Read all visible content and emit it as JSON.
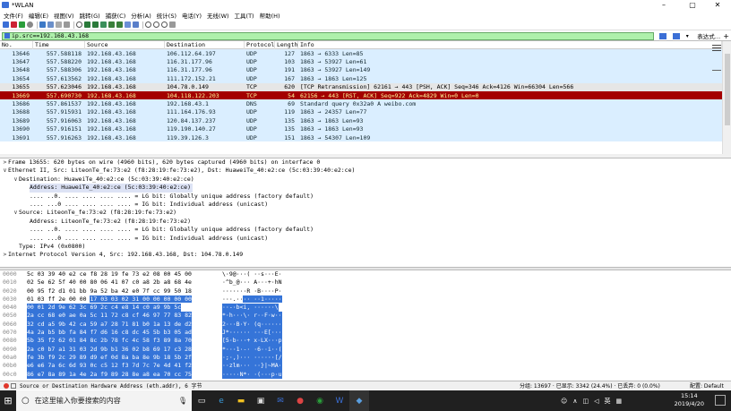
{
  "window": {
    "title": "*WLAN",
    "min": "–",
    "max": "▢",
    "close": "✕"
  },
  "menu": [
    "文件(F)",
    "编辑(E)",
    "视图(V)",
    "跳转(G)",
    "捕获(C)",
    "分析(A)",
    "统计(S)",
    "电话(Y)",
    "无线(W)",
    "工具(T)",
    "帮助(H)"
  ],
  "filter": {
    "value": "ip.src==192.168.43.168",
    "expression_label": "表达式…"
  },
  "columns": [
    "No.",
    "Time",
    "Source",
    "Destination",
    "Protocol",
    "Length",
    "Info"
  ],
  "packets": [
    {
      "no": "13646",
      "time": "557.588118",
      "src": "192.168.43.168",
      "dst": "106.112.64.197",
      "proto": "UDP",
      "len": "127",
      "info": "1863 → 6333 Len=85",
      "style": "udp"
    },
    {
      "no": "13647",
      "time": "557.588220",
      "src": "192.168.43.168",
      "dst": "116.31.177.96",
      "proto": "UDP",
      "len": "103",
      "info": "1863 → 53927 Len=61",
      "style": "udp"
    },
    {
      "no": "13648",
      "time": "557.588306",
      "src": "192.168.43.168",
      "dst": "116.31.177.96",
      "proto": "UDP",
      "len": "191",
      "info": "1863 → 53927 Len=149",
      "style": "udp"
    },
    {
      "no": "13654",
      "time": "557.613562",
      "src": "192.168.43.168",
      "dst": "111.172.152.21",
      "proto": "UDP",
      "len": "167",
      "info": "1863 → 1863 Len=125",
      "style": "udp"
    },
    {
      "no": "13655",
      "time": "557.623046",
      "src": "192.168.43.168",
      "dst": "104.78.0.149",
      "proto": "TCP",
      "len": "620",
      "info": "[TCP Retransmission] 62161 → 443 [PSH, ACK] Seq=346 Ack=4126 Win=66304 Len=566",
      "style": "retrans"
    },
    {
      "no": "13669",
      "time": "557.690730",
      "src": "192.168.43.168",
      "dst": "104.118.122.203",
      "proto": "TCP",
      "len": "54",
      "info": "62156 → 443 [RST, ACK] Seq=922 Ack=4829 Win=0 Len=0",
      "style": "rst"
    },
    {
      "no": "13686",
      "time": "557.861537",
      "src": "192.168.43.168",
      "dst": "192.168.43.1",
      "proto": "DNS",
      "len": "69",
      "info": "Standard query 0x32a0 A weibo.com",
      "style": "dns"
    },
    {
      "no": "13688",
      "time": "557.915931",
      "src": "192.168.43.168",
      "dst": "111.164.176.93",
      "proto": "UDP",
      "len": "119",
      "info": "1863 → 24357 Len=77",
      "style": "udp"
    },
    {
      "no": "13689",
      "time": "557.916063",
      "src": "192.168.43.168",
      "dst": "120.84.137.237",
      "proto": "UDP",
      "len": "135",
      "info": "1863 → 1863 Len=93",
      "style": "udp"
    },
    {
      "no": "13690",
      "time": "557.916151",
      "src": "192.168.43.168",
      "dst": "119.190.140.27",
      "proto": "UDP",
      "len": "135",
      "info": "1863 → 1863 Len=93",
      "style": "udp"
    },
    {
      "no": "13691",
      "time": "557.916263",
      "src": "192.168.43.168",
      "dst": "119.39.126.3",
      "proto": "UDP",
      "len": "151",
      "info": "1863 → 54307 Len=109",
      "style": "udp"
    }
  ],
  "details": [
    {
      "indent": 0,
      "arrow": ">",
      "text": "Frame 13655: 620 bytes on wire (4960 bits), 620 bytes captured (4960 bits) on interface 0"
    },
    {
      "indent": 0,
      "arrow": "∨",
      "text": "Ethernet II, Src: LiteonTe_fe:73:e2 (f8:28:19:fe:73:e2), Dst: HuaweiTe_40:e2:ce (5c:03:39:40:e2:ce)"
    },
    {
      "indent": 1,
      "arrow": "∨",
      "text": "Destination: HuaweiTe_40:e2:ce (5c:03:39:40:e2:ce)"
    },
    {
      "indent": 2,
      "arrow": "",
      "text": "Address: HuaweiTe_40:e2:ce (5c:03:39:40:e2:ce)",
      "sel": true
    },
    {
      "indent": 2,
      "arrow": "",
      "text": ".... ..0. .... .... .... .... = LG bit: Globally unique address (factory default)"
    },
    {
      "indent": 2,
      "arrow": "",
      "text": ".... ...0 .... .... .... .... = IG bit: Individual address (unicast)"
    },
    {
      "indent": 1,
      "arrow": "∨",
      "text": "Source: LiteonTe_fe:73:e2 (f8:28:19:fe:73:e2)"
    },
    {
      "indent": 2,
      "arrow": "",
      "text": "Address: LiteonTe_fe:73:e2 (f8:28:19:fe:73:e2)"
    },
    {
      "indent": 2,
      "arrow": "",
      "text": ".... ..0. .... .... .... .... = LG bit: Globally unique address (factory default)"
    },
    {
      "indent": 2,
      "arrow": "",
      "text": ".... ...0 .... .... .... .... = IG bit: Individual address (unicast)"
    },
    {
      "indent": 1,
      "arrow": "",
      "text": "Type: IPv4 (0x0800)"
    },
    {
      "indent": 0,
      "arrow": ">",
      "text": "Internet Protocol Version 4, Src: 192.168.43.168, Dst: 104.78.0.149"
    }
  ],
  "bytes": [
    {
      "off": "0000",
      "hex": "5c 03 39 40 e2 ce f8 28  19 fe 73 e2 08 00 45 00",
      "asc": "\\·9@···( ··s···E·",
      "hl": 0
    },
    {
      "off": "0010",
      "hex": "02 5e 62 5f 40 00 80 06  41 07 c0 a8 2b a8 68 4e",
      "asc": "·^b_@··· A···+·hN",
      "hl": 0
    },
    {
      "off": "0020",
      "hex": "00 95 f2 d1 01 bb 9a 52  ba 42 e0 7f cc 99 50 18",
      "asc": "·······R ·B····P·",
      "hl": 0
    },
    {
      "off": "0030",
      "hex_a": "01 03 ff 2e 00 00 ",
      "hex_b": "17 03  03 02 31 00 00 00 00 00",
      "asc_a": "···.··",
      "asc_b": "·· ··1·····",
      "hl": 1
    },
    {
      "off": "0040",
      "hex": "00 01 2d 9e 62 3c 69 2c  c4 e8 14 c0 a9 9b 5c",
      "asc": "··-·b<i, ······\\",
      "hl": 2
    },
    {
      "off": "0050",
      "hex": "2a cc 68 e0 ae 0a 5c 11  72 c8 cf 46 97 77 83 82",
      "asc": "*·h···\\· r··F·w··",
      "hl": 2
    },
    {
      "off": "0060",
      "hex": "32 cd a5 9b 42 ca 59 a7  28 71 81 b0 1a 13 de d2",
      "asc": "2···B·Y· (q······",
      "hl": 2
    },
    {
      "off": "0070",
      "hex": "4a 2a b5 bb fa 84 f7 d6  16 c8 dc 45 5b b3 05 ad",
      "asc": "J*······ ···E[···",
      "hl": 2
    },
    {
      "off": "0080",
      "hex": "5b 35 f2 62 01 84 8c 2b  78 fc 4c 58 f3 89 8a 70",
      "asc": "[5·b···+ x·LX···p",
      "hl": 2
    },
    {
      "off": "0090",
      "hex": "2a c0 b7 a1 31 03 2d 9b  b1 36 02 b8 69 17 c3 28",
      "asc": "*···1·-· ·6··i··(",
      "hl": 2
    },
    {
      "off": "00a0",
      "hex": "fe 3b f9 2c 29 89 d9 ef  0d 8a ba 8e 9b 18 5b 2f",
      "asc": "·;·,)··· ······[/",
      "hl": 2
    },
    {
      "off": "00b0",
      "hex": "e6 e6 7a 6c 6d 93 0c c5  12 f3 7d 7c 7e 4d 41 f2",
      "asc": "··zlm··· ··}|~MA·",
      "hl": 2
    },
    {
      "off": "00c0",
      "hex": "86 e7 8a 89 1a 4e 2a f9  89 28 8e a8 ea 70 cc 75",
      "asc": "·····N*· ·(···p·u",
      "hl": 2
    }
  ],
  "status": {
    "left": "Source or Destination Hardware Address (eth.addr), 6 字节",
    "packets": "分组: 13697 · 已显示: 3342 (24.4%) · 已丢弃: 0 (0.0%)",
    "profile": "配置: Default"
  },
  "taskbar": {
    "search_placeholder": "在这里输入你要搜索的内容",
    "time": "15:14",
    "date": "2019/4/20",
    "lang": "英"
  },
  "colors": {
    "udp": "#daeeff",
    "retrans": "#12272e",
    "rst": "#a40000",
    "dns": "#daeeff",
    "selected": "#3574d8"
  }
}
